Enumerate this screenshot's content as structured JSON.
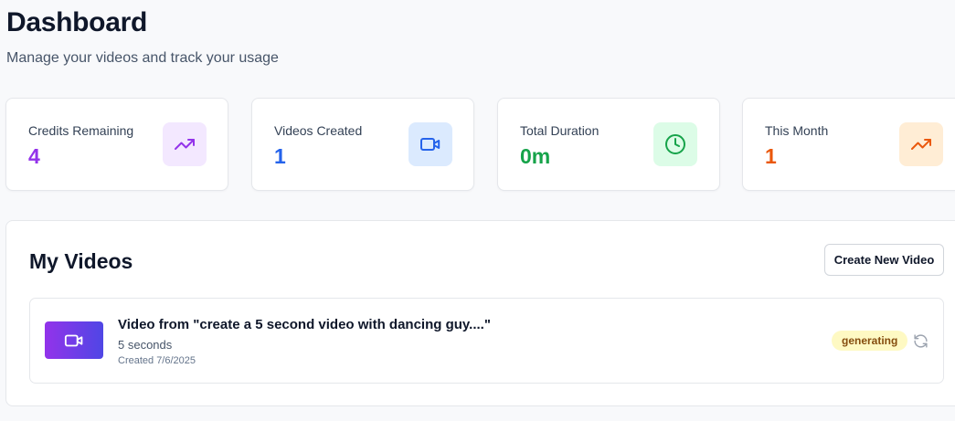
{
  "header": {
    "title": "Dashboard",
    "subtitle": "Manage your videos and track your usage"
  },
  "stats": [
    {
      "label": "Credits Remaining",
      "value": "4",
      "icon": "trending-up-icon",
      "color": "#9333ea",
      "icon_bg": "#f3e8ff"
    },
    {
      "label": "Videos Created",
      "value": "1",
      "icon": "video-icon",
      "color": "#2563eb",
      "icon_bg": "#dbeafe"
    },
    {
      "label": "Total Duration",
      "value": "0m",
      "icon": "clock-icon",
      "color": "#16a34a",
      "icon_bg": "#dcfce7"
    },
    {
      "label": "This Month",
      "value": "1",
      "icon": "trending-up-icon",
      "color": "#ea580c",
      "icon_bg": "#ffedd5"
    }
  ],
  "videos_section": {
    "title": "My Videos",
    "create_button": "Create New Video",
    "items": [
      {
        "title": "Video from \"create a 5 second video with dancing guy....\"",
        "duration": "5 seconds",
        "created": "Created 7/6/2025",
        "status": "generating",
        "thumbnail_icon": "video-icon",
        "action_icon": "refresh-icon"
      }
    ]
  }
}
